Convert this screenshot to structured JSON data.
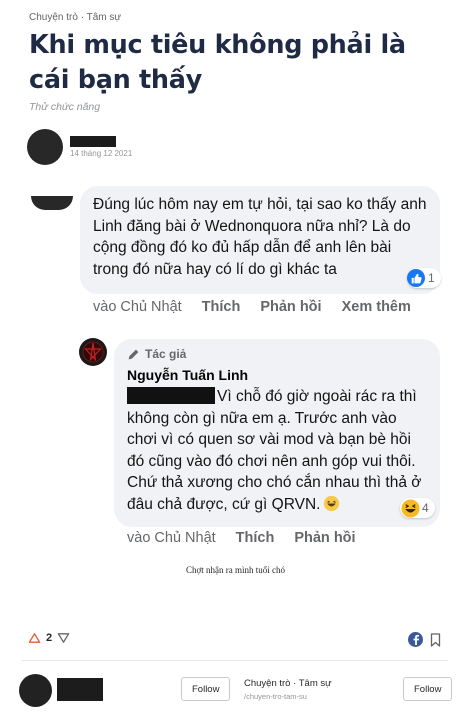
{
  "post": {
    "space_label": "Chuyện trò · Tâm sự",
    "title": "Khi mục tiêu không phải là cái bạn thấy",
    "subtitle": "Thử chức năng",
    "date": "14 tháng 12 2021"
  },
  "comment1": {
    "text": "Đúng lúc hôm nay em tự hỏi, tại sao ko thấy anh Linh đăng bài ở Wednonquora nữa nhỉ? Là do cộng đồng đó ko đủ hấp dẫn để anh lên bài trong đó nữa hay có lí do gì khác ta",
    "reaction_count": "1",
    "actions": {
      "time": "vào Chủ Nhật",
      "like": "Thích",
      "reply": "Phản hồi",
      "more": "Xem thêm"
    }
  },
  "comment2": {
    "badge": "Tác giả",
    "author": "Nguyễn Tuấn Linh",
    "text": "Vì chỗ đó giờ ngoài rác ra thì không còn gì nữa em ạ. Trước anh vào chơi vì có quen sơ vài mod và bạn bè hồi đó cũng vào đó chơi nên anh góp vui thôi. Chứ thả xương cho chó cắn nhau thì thả ở đâu chả được, cứ gì QRVN.",
    "reaction_count": "4",
    "actions": {
      "time": "vào Chủ Nhật",
      "like": "Thích",
      "reply": "Phản hồi"
    }
  },
  "caption": "Chợt nhận ra mình tuổi chó",
  "footer": {
    "upvotes": "2",
    "follow_user": "Follow",
    "space_name": "Chuyện trò · Tâm sự",
    "space_url": "/chuyen-tro-tam-su",
    "follow_space": "Follow"
  },
  "colors": {
    "title": "#1f2a44",
    "bubble": "#f0f2f5",
    "like_blue": "#1877f2",
    "facebook": "#3b5998"
  }
}
